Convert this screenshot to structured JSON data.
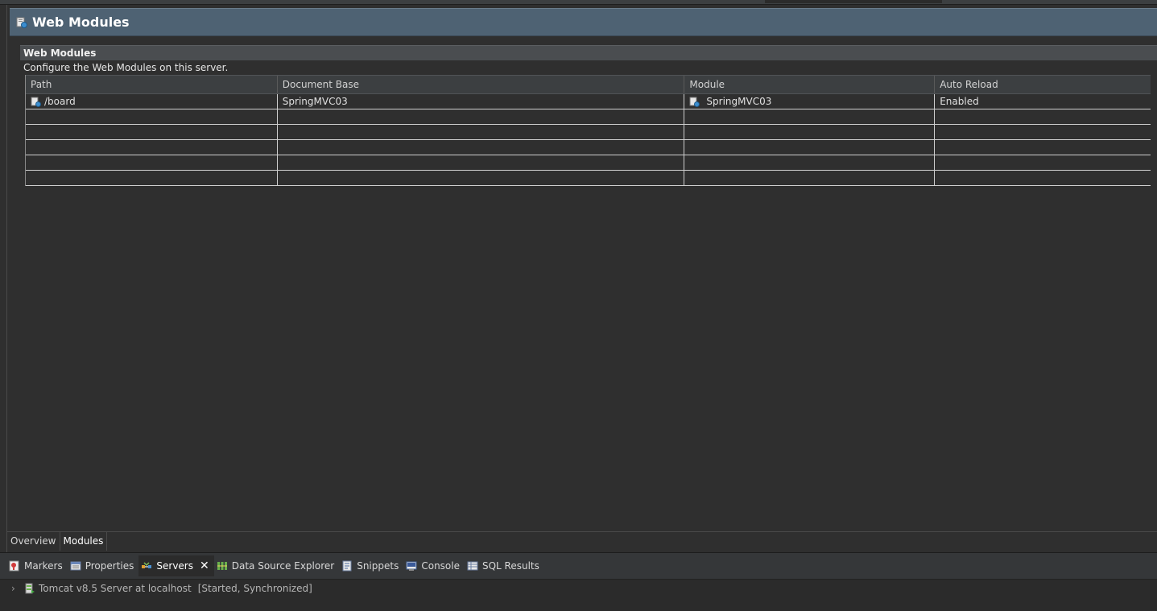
{
  "editor": {
    "title": "Web Modules",
    "section_title": "Web Modules",
    "section_description": "Configure the Web Modules on this server.",
    "table": {
      "columns": [
        "Path",
        "Document Base",
        "Module",
        "Auto Reload"
      ],
      "rows": [
        {
          "path": "/board",
          "document_base": "SpringMVC03",
          "module": "SpringMVC03",
          "auto_reload": "Enabled"
        }
      ]
    },
    "tabs": [
      "Overview",
      "Modules"
    ],
    "active_tab": "Modules"
  },
  "views": {
    "tabs": [
      {
        "label": "Markers",
        "icon": "markers-icon"
      },
      {
        "label": "Properties",
        "icon": "properties-icon"
      },
      {
        "label": "Servers",
        "icon": "servers-icon"
      },
      {
        "label": "Data Source Explorer",
        "icon": "data-source-explorer-icon"
      },
      {
        "label": "Snippets",
        "icon": "snippets-icon"
      },
      {
        "label": "Console",
        "icon": "console-icon"
      },
      {
        "label": "SQL Results",
        "icon": "sql-results-icon"
      }
    ],
    "active_tab": "Servers",
    "server": {
      "name": "Tomcat v8.5 Server at localhost",
      "status": "[Started, Synchronized]"
    }
  }
}
